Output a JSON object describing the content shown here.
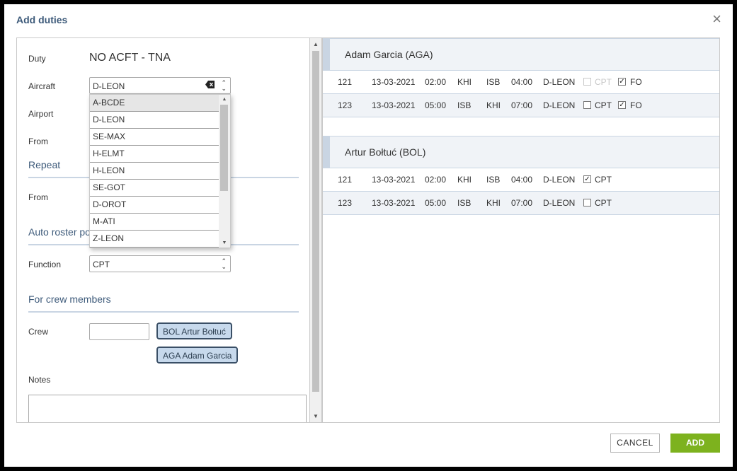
{
  "dialog": {
    "title": "Add duties",
    "close_icon": "close-icon",
    "cancel_label": "CANCEL",
    "add_label": "ADD",
    "colors": {
      "title": "#3d5a7a",
      "add_button": "#7db21e",
      "chip_bg": "#c7d9ec",
      "header_bg": "#f0f3f7"
    }
  },
  "form": {
    "duty_label": "Duty",
    "duty_value": "NO ACFT - TNA",
    "aircraft_label": "Aircraft",
    "aircraft_value": "D-LEON",
    "airport_label": "Airport",
    "from_label": "From",
    "repeat_heading": "Repeat",
    "repeat_from_label": "From",
    "auto_roster_heading": "Auto roster po",
    "function_label": "Function",
    "function_value": "CPT",
    "crew_heading": "For crew members",
    "crew_label": "Crew",
    "notes_label": "Notes",
    "crew_chips": [
      "BOL Artur Bołtuć",
      "AGA Adam Garcia"
    ]
  },
  "aircraft_dropdown": {
    "options": [
      "A-BCDE",
      "D-LEON",
      "SE-MAX",
      "H-ELMT",
      "H-LEON",
      "SE-GOT",
      "D-OROT",
      "M-ATI",
      "Z-LEON"
    ],
    "highlighted": "A-BCDE"
  },
  "crew_duties": [
    {
      "name": "Adam Garcia (AGA)",
      "rows": [
        {
          "flight": "121",
          "date": "13-03-2021",
          "dep_time": "02:00",
          "from": "KHI",
          "to": "ISB",
          "arr_time": "04:00",
          "aircraft": "D-LEON",
          "cpt_label": "CPT",
          "cpt": false,
          "cpt_disabled": true,
          "fo_label": "FO",
          "fo": true
        },
        {
          "flight": "123",
          "date": "13-03-2021",
          "dep_time": "05:00",
          "from": "ISB",
          "to": "KHI",
          "arr_time": "07:00",
          "aircraft": "D-LEON",
          "cpt_label": "CPT",
          "cpt": false,
          "cpt_disabled": false,
          "fo_label": "FO",
          "fo": true
        }
      ]
    },
    {
      "name": "Artur Bołtuć (BOL)",
      "rows": [
        {
          "flight": "121",
          "date": "13-03-2021",
          "dep_time": "02:00",
          "from": "KHI",
          "to": "ISB",
          "arr_time": "04:00",
          "aircraft": "D-LEON",
          "cpt_label": "CPT",
          "cpt": true,
          "cpt_disabled": false
        },
        {
          "flight": "123",
          "date": "13-03-2021",
          "dep_time": "05:00",
          "from": "ISB",
          "to": "KHI",
          "arr_time": "07:00",
          "aircraft": "D-LEON",
          "cpt_label": "CPT",
          "cpt": false,
          "cpt_disabled": false
        }
      ]
    }
  ]
}
